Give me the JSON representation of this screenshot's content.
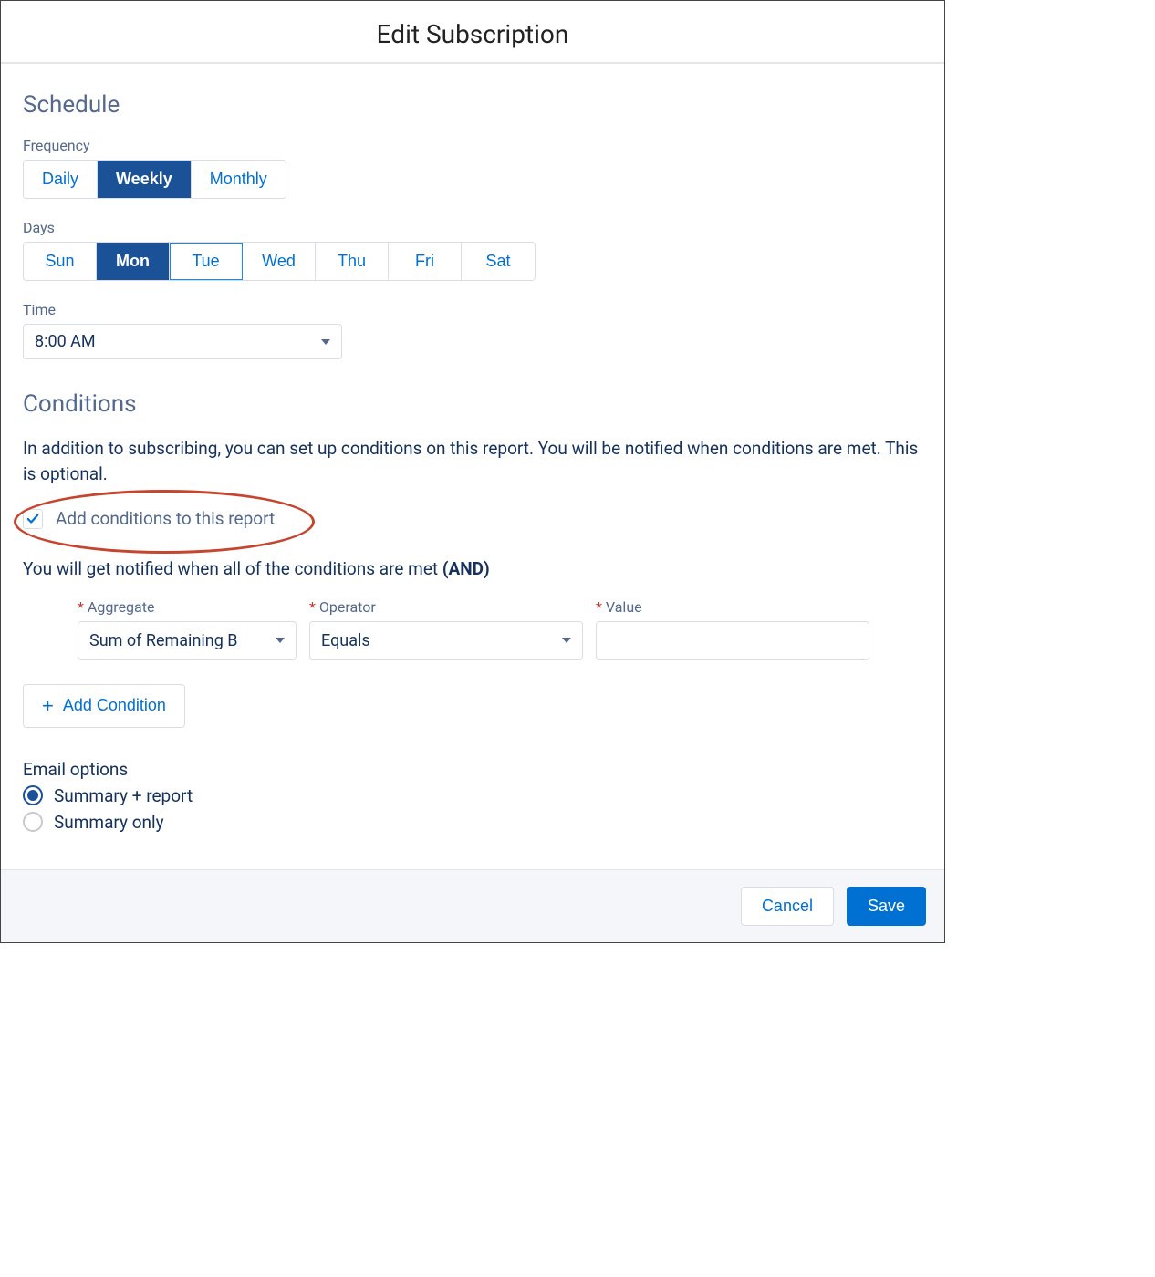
{
  "title": "Edit Subscription",
  "schedule": {
    "heading": "Schedule",
    "frequency_label": "Frequency",
    "frequency": {
      "options": [
        "Daily",
        "Weekly",
        "Monthly"
      ],
      "selected": "Weekly"
    },
    "days_label": "Days",
    "days": {
      "options": [
        "Sun",
        "Mon",
        "Tue",
        "Wed",
        "Thu",
        "Fri",
        "Sat"
      ],
      "selected": "Mon",
      "focused": "Tue"
    },
    "time_label": "Time",
    "time_value": "8:00 AM"
  },
  "conditions": {
    "heading": "Conditions",
    "description": "In addition to subscribing, you can set up conditions on this report. You will be notified when conditions are met. This is optional.",
    "checkbox_label": "Add conditions to this report",
    "checkbox_checked": true,
    "notify_text_prefix": "You will get notified when all of the conditions are met ",
    "notify_text_bold": "(AND)",
    "fields": {
      "aggregate_label": "Aggregate",
      "aggregate_value": "Sum of Remaining B",
      "operator_label": "Operator",
      "operator_value": "Equals",
      "value_label": "Value",
      "value_value": ""
    },
    "add_button": "Add Condition"
  },
  "email": {
    "heading": "Email options",
    "options": [
      "Summary + report",
      "Summary only"
    ],
    "selected": "Summary + report"
  },
  "footer": {
    "cancel": "Cancel",
    "save": "Save"
  }
}
